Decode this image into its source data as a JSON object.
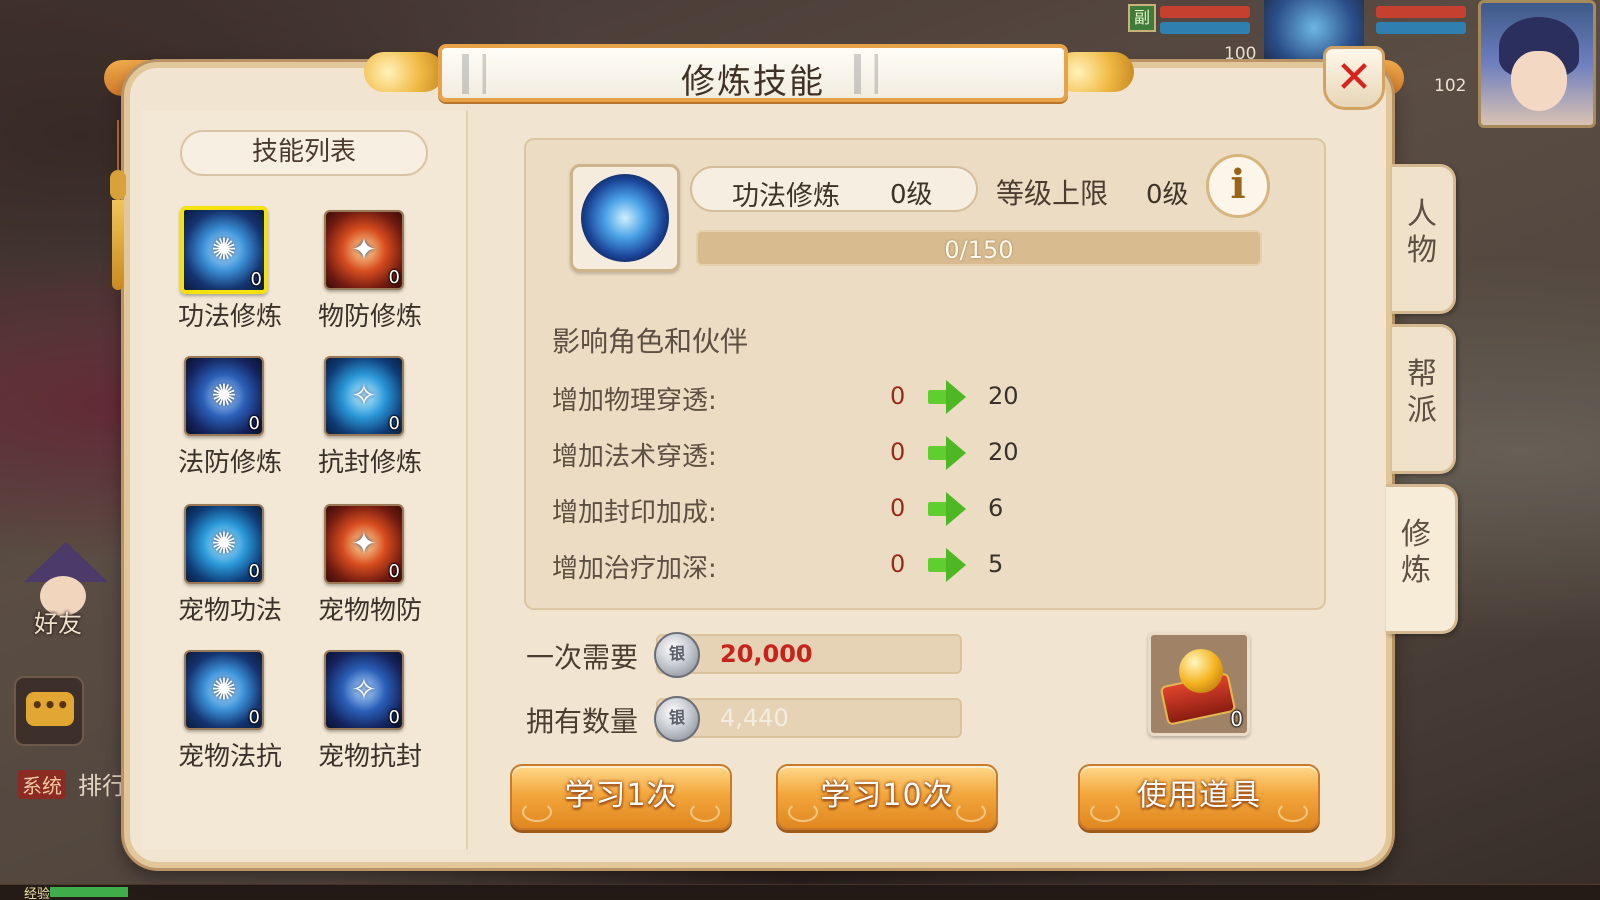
{
  "hud": {
    "minimap_label": "副",
    "pet_hp_text": "100",
    "char_hp_text": "102",
    "friend_label": "好友",
    "chat_icon_text": "•••",
    "system_tag": "系统",
    "system_text": "排行",
    "exp_label": "经验",
    "exp_progress": 0.05
  },
  "dialog": {
    "title": "修炼技能",
    "close_icon": "close-icon"
  },
  "skill_list": {
    "header": "技能列表",
    "items": [
      {
        "name": "功法修炼",
        "count": "0",
        "glyph": "✺",
        "selected": true
      },
      {
        "name": "物防修炼",
        "count": "0",
        "glyph": "✦",
        "selected": false
      },
      {
        "name": "法防修炼",
        "count": "0",
        "glyph": "✺",
        "selected": false
      },
      {
        "name": "抗封修炼",
        "count": "0",
        "glyph": "✧",
        "selected": false
      },
      {
        "name": "宠物功法",
        "count": "0",
        "glyph": "✺",
        "selected": false
      },
      {
        "name": "宠物物防",
        "count": "0",
        "glyph": "✦",
        "selected": false
      },
      {
        "name": "宠物法抗",
        "count": "0",
        "glyph": "✺",
        "selected": false
      },
      {
        "name": "宠物抗封",
        "count": "0",
        "glyph": "✧",
        "selected": false
      }
    ]
  },
  "detail": {
    "skill_name": "功法修炼",
    "skill_level": "0级",
    "cap_label": "等级上限",
    "cap_value": "0级",
    "info_icon": "i",
    "progress_text": "0/150",
    "progress_current": 0,
    "progress_max": 150,
    "affect_title": "影响角色和伙伴",
    "stats": [
      {
        "label": "增加物理穿透:",
        "from": "0",
        "to": "20"
      },
      {
        "label": "增加法术穿透:",
        "from": "0",
        "to": "20"
      },
      {
        "label": "增加封印加成:",
        "from": "0",
        "to": "6"
      },
      {
        "label": "增加治疗加深:",
        "from": "0",
        "to": "5"
      }
    ]
  },
  "cost": {
    "need_label": "一次需要",
    "need_value": "20,000",
    "need_color": "#c6231a",
    "own_label": "拥有数量",
    "own_value": "4,440",
    "own_color": "#f4ece0",
    "coin_icon_text": "银"
  },
  "item": {
    "count": "0"
  },
  "buttons": {
    "learn_once": "学习1次",
    "learn_ten": "学习10次",
    "use_item": "使用道具"
  },
  "side_tabs": [
    {
      "label": "人物",
      "active": false
    },
    {
      "label": "帮派",
      "active": false
    },
    {
      "label": "修炼",
      "active": true
    }
  ]
}
